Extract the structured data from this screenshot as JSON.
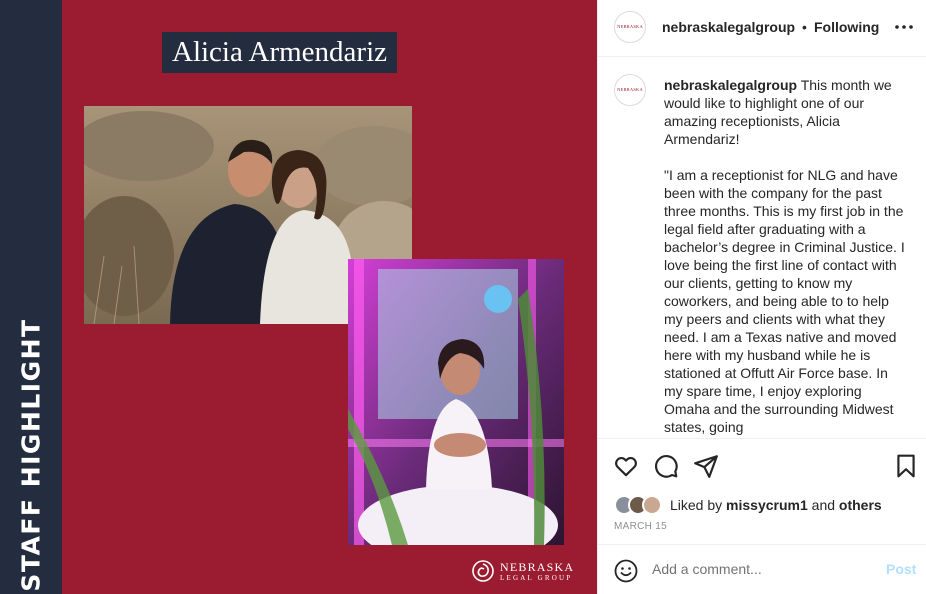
{
  "media": {
    "strip_label": "STAFF HIGHLIGHT",
    "name_title": "Alicia Armendariz",
    "brand_line1": "NEBRASKA",
    "brand_line2": "LEGAL GROUP",
    "bg_color": "#9b1b30",
    "strip_color": "#232d3f"
  },
  "header": {
    "username": "nebraskalegalgroup",
    "separator": "•",
    "follow_label": "Following",
    "more_icon": "more-horizontal-icon"
  },
  "caption": {
    "username": "nebraskalegalgroup",
    "intro": "This month we would like to highlight one of our amazing receptionists, Alicia Armendariz!",
    "quote": "\"I am a receptionist for NLG and have been with the company for the past three months. This is my first job in the legal field after graduating with a bachelor’s degree in Criminal Justice. I love being the first line of contact with our clients, getting to know my coworkers, and being able to to help my peers and clients with what they need. I am a Texas native and moved here with my husband while he is stationed at Offutt Air Force base. In my spare time, I enjoy exploring Omaha and the surrounding Midwest states, going"
  },
  "actions": {
    "like_icon": "heart-icon",
    "comment_icon": "comment-icon",
    "share_icon": "share-icon",
    "save_icon": "bookmark-icon"
  },
  "likes": {
    "prefix": "Liked by",
    "user": "missycrum1",
    "conjunction": "and",
    "others": "others"
  },
  "date": "MARCH 15",
  "comment": {
    "placeholder": "Add a comment...",
    "post_label": "Post",
    "emoji_icon": "smiley-icon"
  }
}
